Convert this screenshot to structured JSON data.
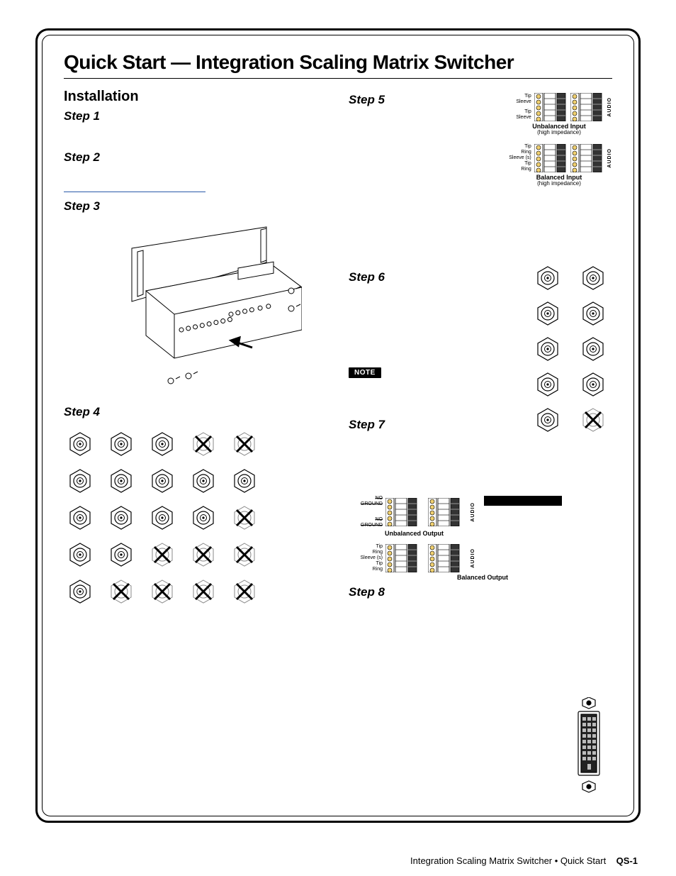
{
  "title": "Quick Start — Integration Scaling Matrix Switcher",
  "left": {
    "section": "Installation",
    "step1": "Step 1",
    "step2": "Step 2",
    "step3": "Step 3",
    "step4": "Step 4"
  },
  "right": {
    "step5": "Step 5",
    "step6": "Step 6",
    "note": "NOTE",
    "step7": "Step 7",
    "step8": "Step 8"
  },
  "audio": {
    "unbal_in_title": "Unbalanced Input",
    "unbal_in_sub": "(high impedance)",
    "bal_in_title": "Balanced Input",
    "bal_in_sub": "(high impedance)",
    "unbal_out_title": "Unbalanced Output",
    "bal_out_title": "Balanced Output",
    "side": "AUDIO",
    "lbl_tip": "Tip",
    "lbl_ring": "Ring",
    "lbl_sleeve": "Sleeve",
    "lbl_sleeve_s": "Sleeve (s)",
    "lbl_noground": "NO GROUND"
  },
  "footer": {
    "a": "Integration Scaling Matrix Switcher • Quick Start",
    "b": "QS-1"
  }
}
